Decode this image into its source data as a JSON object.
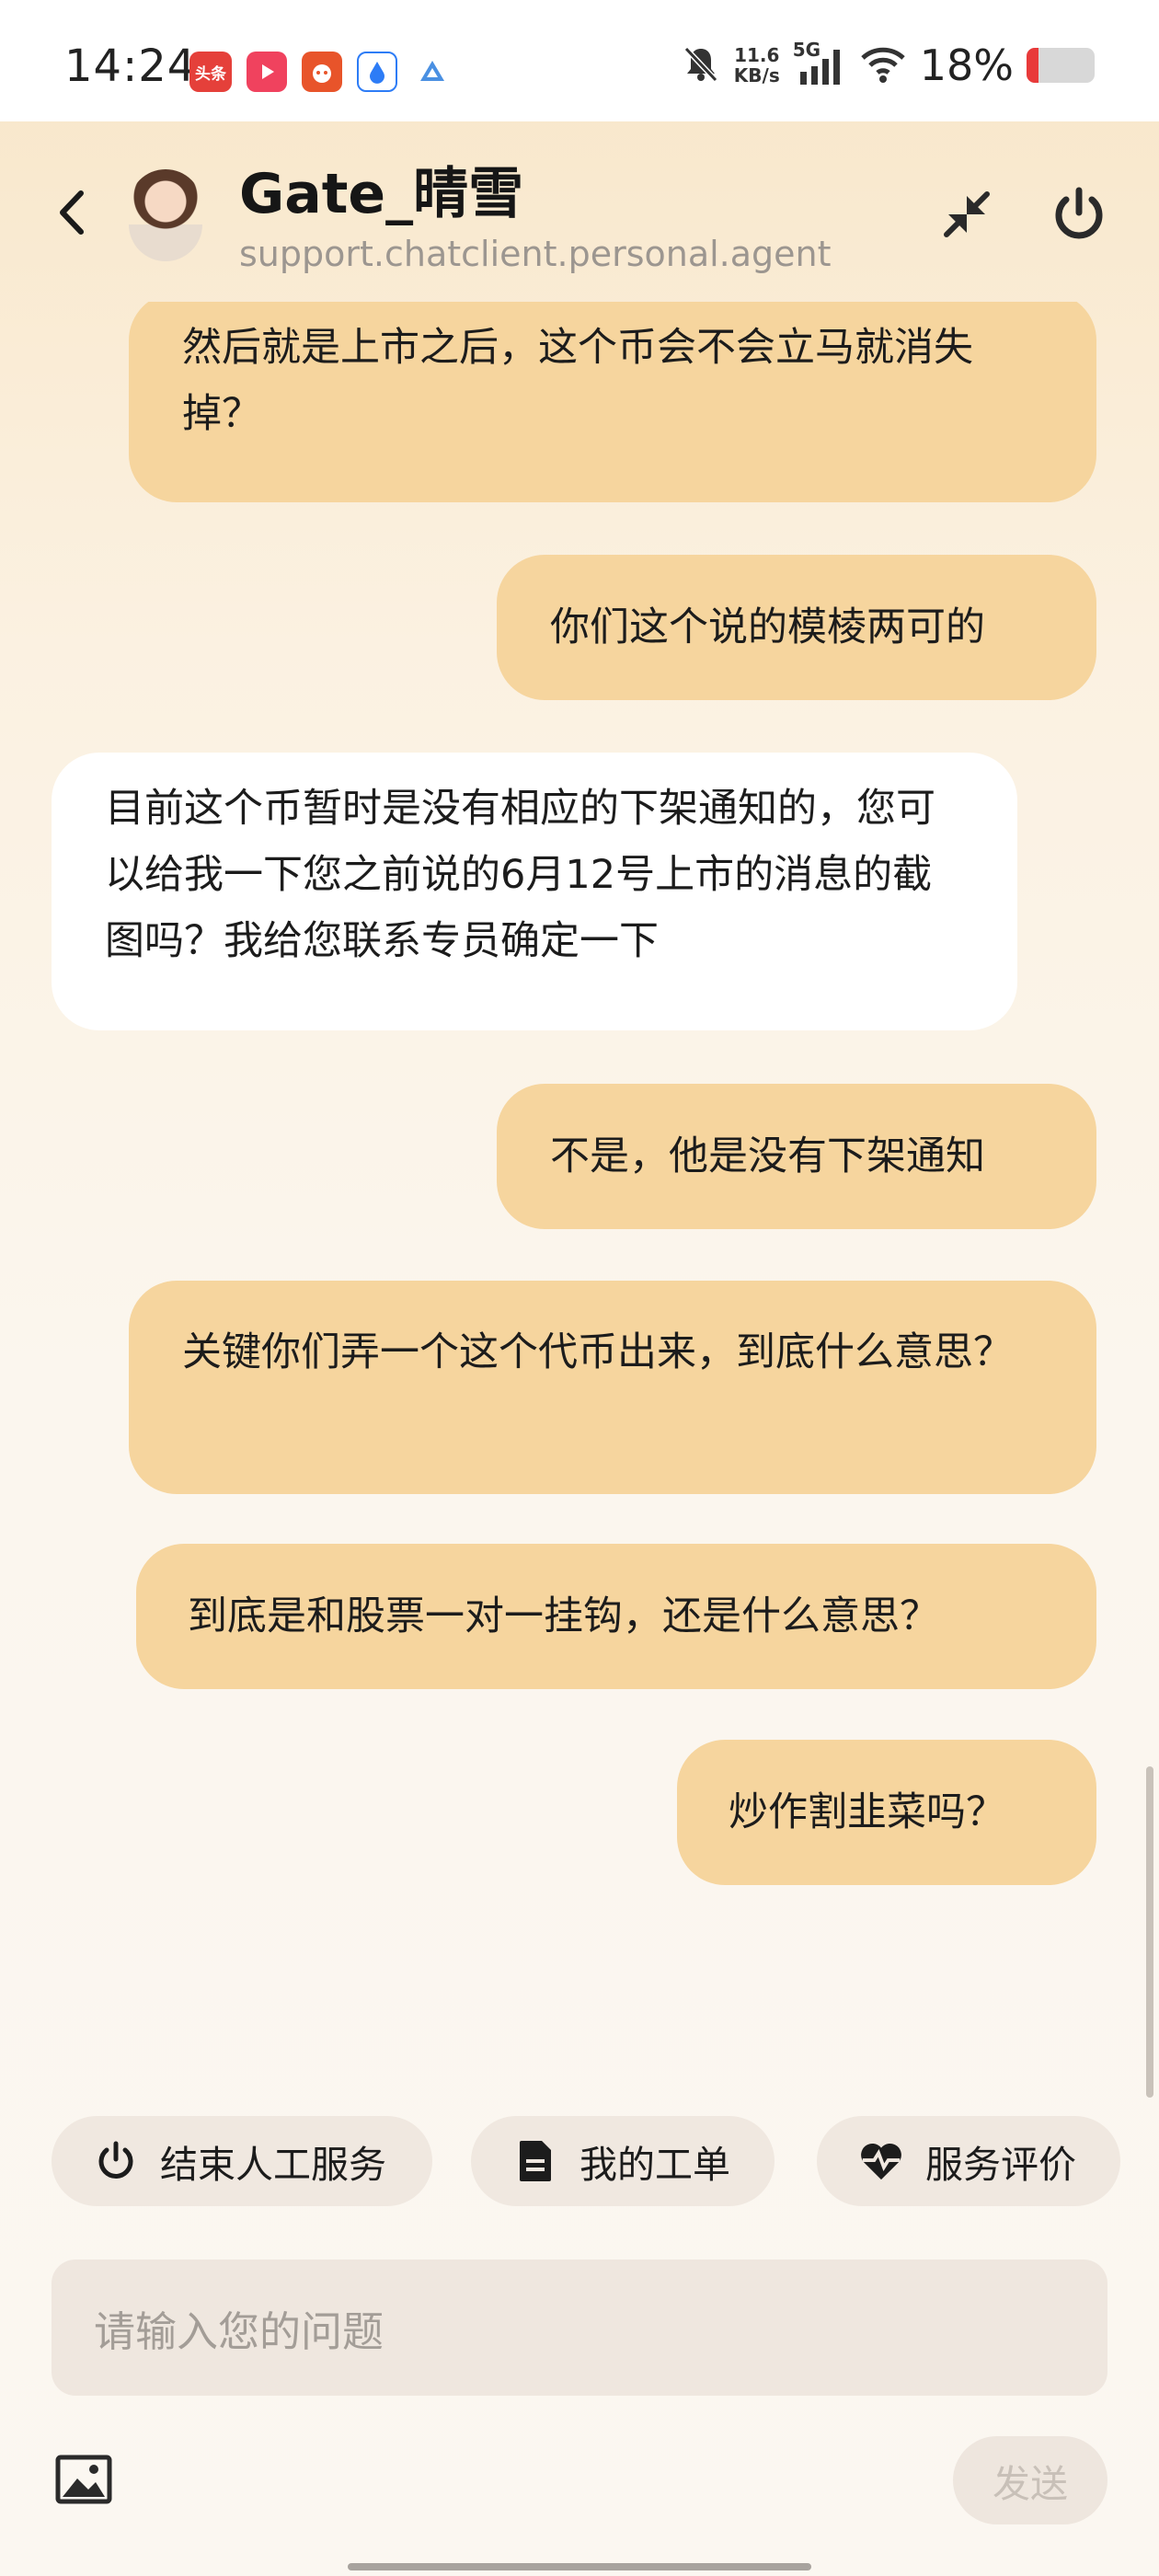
{
  "status_bar": {
    "time": "14:24",
    "apps": [
      {
        "icon": "toutiao-app-icon",
        "label": "头条",
        "color": "#e5403a"
      },
      {
        "icon": "video-app-icon",
        "label": "",
        "color": "#f0425e"
      },
      {
        "icon": "taobao-app-icon",
        "label": "",
        "color": "#e8542a"
      },
      {
        "icon": "baidu-app-icon",
        "label": "",
        "color": "#2d7cf6"
      },
      {
        "icon": "alert-app-icon",
        "label": "",
        "color": "#4a90e2"
      }
    ],
    "mute_icon": "bell-off-icon",
    "net_speed_value": "11.6",
    "net_speed_unit": "KB/s",
    "network_type": "5G",
    "battery_percent": "18%",
    "battery_level": 0.18,
    "battery_color": "#e83a3a"
  },
  "header": {
    "title": "Gate_晴雪",
    "subtitle": "support.chatclient.personal.agent"
  },
  "messages": [
    {
      "sender": "user",
      "text": "然后就是上市之后，这个币会不会立马就消失掉？"
    },
    {
      "sender": "user",
      "text": "你们这个说的模棱两可的"
    },
    {
      "sender": "agent",
      "text": "目前这个币暂时是没有相应的下架通知的，您可以给我一下您之前说的6月12号上市的消息的截图吗？我给您联系专员确定一下"
    },
    {
      "sender": "user",
      "text": "不是，他是没有下架通知"
    },
    {
      "sender": "user",
      "text": "关键你们弄一个这个代币出来，到底什么意思？"
    },
    {
      "sender": "user",
      "text": "到底是和股票一对一挂钩，还是什么意思？"
    },
    {
      "sender": "user",
      "text": "炒作割韭菜吗？"
    }
  ],
  "quick_actions": {
    "end_service": "结束人工服务",
    "my_tickets": "我的工单",
    "rate_service": "服务评价"
  },
  "input": {
    "placeholder": "请输入您的问题",
    "send_label": "发送"
  },
  "colors": {
    "user_bubble": "#f6d59e",
    "agent_bubble": "#ffffff"
  }
}
